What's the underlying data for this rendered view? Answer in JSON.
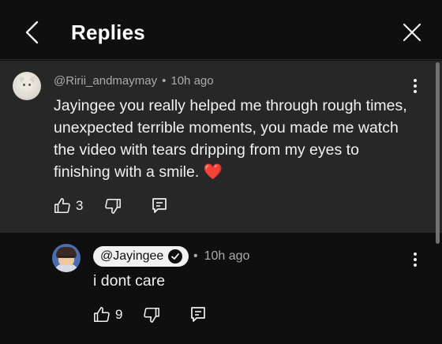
{
  "header": {
    "back_icon": "chevron-left-icon",
    "title": "Replies",
    "close_icon": "close-icon"
  },
  "comment": {
    "author": "@Ririi_andmaymay",
    "separator": "•",
    "time": "10h ago",
    "text": "Jayingee you really helped me through rough times, unexpected terrible moments, you made me watch the video with tears dripping from my eyes to finishing with a smile. ",
    "emoji": "❤️",
    "like_count": "3",
    "icons": [
      "thumbs-up-icon",
      "thumbs-down-icon",
      "reply-icon",
      "more-vert-icon"
    ],
    "background": "#272727"
  },
  "reply": {
    "author": "@Jayingee",
    "verified": true,
    "separator": "•",
    "time": "10h ago",
    "text": "i dont care",
    "like_count": "9",
    "icons": [
      "thumbs-up-icon",
      "thumbs-down-icon",
      "reply-icon",
      "more-vert-icon"
    ],
    "badge_background": "#f1f1f1"
  },
  "colors": {
    "background": "#0f0f0f",
    "text": "#f1f1f1",
    "secondary_text": "#aaaaaa",
    "heart": "#e0142f"
  }
}
